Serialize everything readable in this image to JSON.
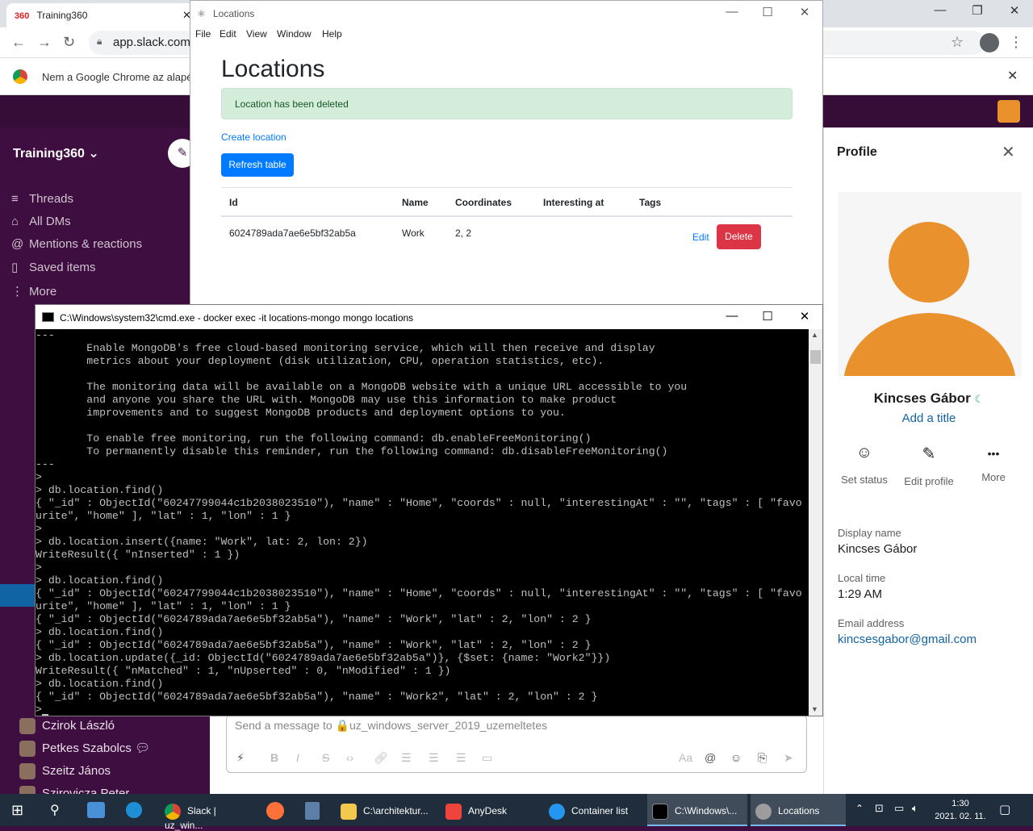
{
  "chrome": {
    "tab_title": "Training360",
    "tab_favicon": "360",
    "url": "app.slack.com/",
    "infobar_text": "Nem a Google Chrome az alapé"
  },
  "slack": {
    "workspace": "Training360",
    "sidebar_items": [
      {
        "icon": "threads-icon",
        "glyph": "≡",
        "label": "Threads"
      },
      {
        "icon": "dms-icon",
        "glyph": "⌂",
        "label": "All DMs"
      },
      {
        "icon": "mentions-icon",
        "glyph": "@",
        "label": "Mentions & reactions"
      },
      {
        "icon": "bookmark-icon",
        "glyph": "▯",
        "label": "Saved items"
      },
      {
        "icon": "more-icon",
        "glyph": "⋮",
        "label": "More"
      }
    ],
    "people": [
      {
        "name": "Czirok László"
      },
      {
        "name": "Petkes Szabolcs"
      },
      {
        "name": "Szeitz János"
      },
      {
        "name": "Szirovicza Peter"
      }
    ],
    "composer_placeholder": "Send a message to 🔒uz_windows_server_2019_uzemeltetes"
  },
  "profile": {
    "header": "Profile",
    "name": "Kincses Gábor",
    "add_title": "Add a title",
    "actions": [
      {
        "icon": "smile-icon",
        "glyph": "☺",
        "label": "Set status"
      },
      {
        "icon": "pencil-icon",
        "glyph": "✎",
        "label": "Edit profile"
      },
      {
        "icon": "ellipsis-icon",
        "glyph": "•••",
        "label": "More"
      }
    ],
    "display_name_label": "Display name",
    "display_name": "Kincses Gábor",
    "local_time_label": "Local time",
    "local_time": "1:29 AM",
    "email_label": "Email address",
    "email": "kincsesgabor@gmail.com",
    "avatar_color": "#e8912d"
  },
  "locations_window": {
    "title": "Locations",
    "menu": [
      "File",
      "Edit",
      "View",
      "Window",
      "Help"
    ],
    "heading": "Locations",
    "alert": "Location has been deleted",
    "create_link": "Create location",
    "refresh_button": "Refresh table",
    "columns": [
      "Id",
      "Name",
      "Coordinates",
      "Interesting at",
      "Tags"
    ],
    "rows": [
      {
        "id": "6024789ada7ae6e5bf32ab5a",
        "name": "Work",
        "coordinates": "2, 2",
        "interesting_at": "",
        "tags": "",
        "edit": "Edit",
        "delete": "Delete"
      }
    ],
    "colors": {
      "primary": "#007bff",
      "danger": "#dc3545",
      "alert_bg": "#d4edda"
    }
  },
  "cmd_window": {
    "title": "C:\\Windows\\system32\\cmd.exe - docker  exec -it locations-mongo mongo locations",
    "lines": [
      "---",
      "        Enable MongoDB's free cloud-based monitoring service, which will then receive and display",
      "        metrics about your deployment (disk utilization, CPU, operation statistics, etc).",
      "",
      "        The monitoring data will be available on a MongoDB website with a unique URL accessible to you",
      "        and anyone you share the URL with. MongoDB may use this information to make product",
      "        improvements and to suggest MongoDB products and deployment options to you.",
      "",
      "        To enable free monitoring, run the following command: db.enableFreeMonitoring()",
      "        To permanently disable this reminder, run the following command: db.disableFreeMonitoring()",
      "---",
      ">",
      "> db.location.find()",
      "{ \"_id\" : ObjectId(\"60247799044c1b2038023510\"), \"name\" : \"Home\", \"coords\" : null, \"interestingAt\" : \"\", \"tags\" : [ \"favo",
      "urite\", \"home\" ], \"lat\" : 1, \"lon\" : 1 }",
      ">",
      "> db.location.insert({name: \"Work\", lat: 2, lon: 2})",
      "WriteResult({ \"nInserted\" : 1 })",
      ">",
      "> db.location.find()",
      "{ \"_id\" : ObjectId(\"60247799044c1b2038023510\"), \"name\" : \"Home\", \"coords\" : null, \"interestingAt\" : \"\", \"tags\" : [ \"favo",
      "urite\", \"home\" ], \"lat\" : 1, \"lon\" : 1 }",
      "{ \"_id\" : ObjectId(\"6024789ada7ae6e5bf32ab5a\"), \"name\" : \"Work\", \"lat\" : 2, \"lon\" : 2 }",
      "> db.location.find()",
      "{ \"_id\" : ObjectId(\"6024789ada7ae6e5bf32ab5a\"), \"name\" : \"Work\", \"lat\" : 2, \"lon\" : 2 }",
      "> db.location.update({_id: ObjectId(\"6024789ada7ae6e5bf32ab5a\")}, {$set: {name: \"Work2\"}})",
      "WriteResult({ \"nMatched\" : 1, \"nUpserted\" : 0, \"nModified\" : 1 })",
      "> db.location.find()",
      "{ \"_id\" : ObjectId(\"6024789ada7ae6e5bf32ab5a\"), \"name\" : \"Work2\", \"lat\" : 2, \"lon\" : 2 }",
      ">"
    ]
  },
  "taskbar": {
    "items": [
      {
        "label": "Slack | uz_win...",
        "color": "#4a154b"
      },
      {
        "label": "C:\\architektur...",
        "color": "#f2c94c"
      },
      {
        "label": "AnyDesk",
        "color": "#ef443b"
      },
      {
        "label": "Container list",
        "color": "#2496ed"
      },
      {
        "label": "C:\\Windows\\...",
        "color": "#000000"
      },
      {
        "label": "Locations",
        "color": "#9c9c9c"
      }
    ],
    "time": "1:30",
    "date": "2021. 02. 11."
  }
}
